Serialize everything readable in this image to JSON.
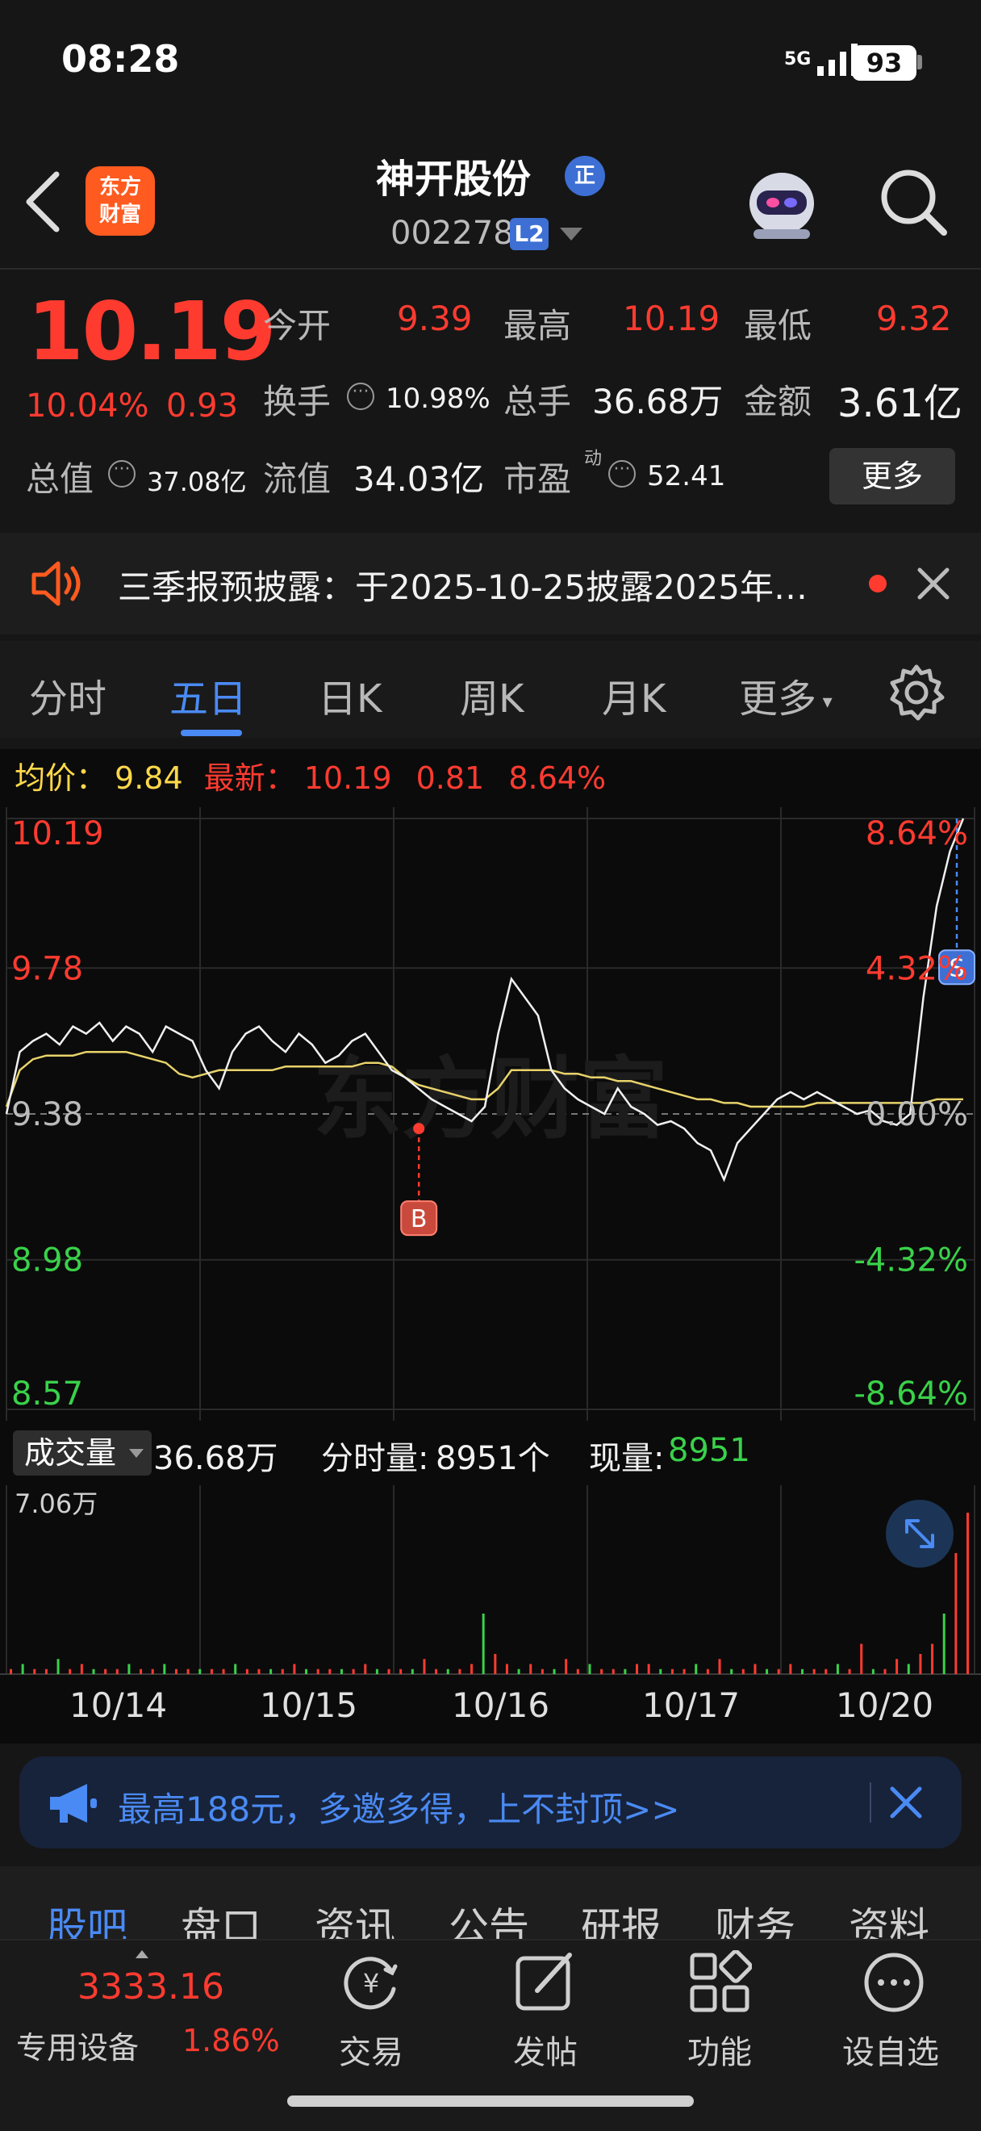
{
  "status_bar": {
    "time": "08:28",
    "network": "5G",
    "battery": "93"
  },
  "header": {
    "logo": "东方财富",
    "stock_name": "神开股份",
    "stock_badge": "正",
    "stock_code": "002278",
    "level_badge": "L2"
  },
  "quote": {
    "price": "10.19",
    "change_pct": "10.04%",
    "change": "0.93",
    "open_label": "今开",
    "open": "9.39",
    "high_label": "最高",
    "high": "10.19",
    "low_label": "最低",
    "low": "9.32",
    "turnover_label": "换手",
    "turnover": "10.98%",
    "volume_label": "总手",
    "volume": "36.68万",
    "amount_label": "金额",
    "amount": "3.61亿",
    "total_cap_label": "总值",
    "total_cap": "37.08亿",
    "float_cap_label": "流值",
    "float_cap": "34.03亿",
    "pe_label": "市盈",
    "pe_sup": "动",
    "pe": "52.41",
    "more_label": "更多"
  },
  "notice": {
    "text": "三季报预披露：于2025-10-25披露2025年…"
  },
  "tabs": [
    "分时",
    "五日",
    "日K",
    "周K",
    "月K",
    "更多"
  ],
  "active_tab": "五日",
  "info_line": {
    "avg_label": "均价：",
    "avg": "9.84",
    "latest_label": "最新：",
    "latest": "10.19",
    "latest_chg": "0.81",
    "latest_pct": "8.64%"
  },
  "chart_data": {
    "type": "line",
    "x": [
      "10/14",
      "10/15",
      "10/16",
      "10/17",
      "10/20"
    ],
    "y_ticks_left": [
      "10.19",
      "9.78",
      "9.38",
      "8.98",
      "8.57"
    ],
    "y_ticks_right": [
      "8.64%",
      "4.32%",
      "0.00%",
      "-4.32%",
      "-8.64%"
    ],
    "ylim": [
      8.57,
      10.19
    ],
    "prev_close": 9.38,
    "series": [],
    "price": [
      9.38,
      9.55,
      9.58,
      9.6,
      9.57,
      9.62,
      9.6,
      9.63,
      9.58,
      9.62,
      9.6,
      9.55,
      9.62,
      9.6,
      9.58,
      9.5,
      9.45,
      9.55,
      9.6,
      9.62,
      9.58,
      9.55,
      9.6,
      9.57,
      9.52,
      9.54,
      9.58,
      9.6,
      9.55,
      9.5,
      9.48,
      9.45,
      9.42,
      9.4,
      9.38,
      9.36,
      9.4,
      9.6,
      9.75,
      9.7,
      9.65,
      9.5,
      9.45,
      9.42,
      9.4,
      9.38,
      9.45,
      9.4,
      9.38,
      9.35,
      9.36,
      9.34,
      9.3,
      9.28,
      9.2,
      9.3,
      9.34,
      9.38,
      9.42,
      9.44,
      9.42,
      9.44,
      9.42,
      9.4,
      9.38,
      9.39,
      9.36,
      9.35,
      9.38,
      9.7,
      9.95,
      10.1,
      10.19
    ],
    "average": [
      9.4,
      9.5,
      9.53,
      9.54,
      9.54,
      9.54,
      9.55,
      9.55,
      9.55,
      9.55,
      9.54,
      9.53,
      9.52,
      9.49,
      9.48,
      9.49,
      9.5,
      9.5,
      9.5,
      9.5,
      9.5,
      9.51,
      9.51,
      9.51,
      9.51,
      9.51,
      9.51,
      9.52,
      9.52,
      9.51,
      9.48,
      9.46,
      9.45,
      9.44,
      9.43,
      9.42,
      9.42,
      9.45,
      9.5,
      9.5,
      9.5,
      9.5,
      9.49,
      9.49,
      9.48,
      9.48,
      9.47,
      9.47,
      9.46,
      9.45,
      9.44,
      9.43,
      9.42,
      9.42,
      9.41,
      9.41,
      9.4,
      9.4,
      9.4,
      9.4,
      9.4,
      9.41,
      9.41,
      9.41,
      9.41,
      9.41,
      9.41,
      9.41,
      9.41,
      9.41,
      9.42,
      9.42,
      9.42
    ],
    "markers": [
      {
        "label": "B",
        "date": "10/16"
      },
      {
        "label": "S",
        "date": "10/20"
      }
    ],
    "volume_top_label": "7.06万",
    "watermark": "东方财富"
  },
  "volume_header": {
    "select_label": "成交量",
    "total": "36.68万",
    "minute_label": "分时量:",
    "minute_value": "8951个",
    "current_label": "现量:",
    "current_value": "8951"
  },
  "volume_bars": [
    1,
    2,
    1,
    1,
    3,
    1,
    2,
    1,
    1,
    1,
    2,
    1,
    1,
    2,
    1,
    1,
    1,
    1,
    1,
    2,
    1,
    1,
    1,
    1,
    2,
    1,
    1,
    1,
    1,
    1,
    2,
    1,
    1,
    1,
    1,
    3,
    1,
    1,
    1,
    2,
    12,
    4,
    2,
    1,
    2,
    1,
    1,
    3,
    1,
    2,
    1,
    1,
    1,
    2,
    2,
    1,
    1,
    1,
    2,
    1,
    3,
    1,
    1,
    2,
    1,
    1,
    2,
    1,
    1,
    1,
    2,
    1,
    6,
    1,
    1,
    3,
    2,
    4,
    6,
    12,
    24,
    32
  ],
  "promo": {
    "text": "最高188元，多邀多得，上不封顶>>"
  },
  "sub_nav": [
    "股吧",
    "盘口",
    "资讯",
    "公告",
    "研报",
    "财务",
    "资料"
  ],
  "active_sub_nav": "股吧",
  "bottom_bar": {
    "index_value": "3333.16",
    "index_name": "专用设备",
    "index_pct": "1.86%",
    "items": [
      "交易",
      "发帖",
      "功能",
      "设自选"
    ]
  },
  "colors": {
    "up": "#ff3b30",
    "down": "#3ad14a",
    "accent": "#4a8af4",
    "avg_line": "#e8d36a"
  }
}
